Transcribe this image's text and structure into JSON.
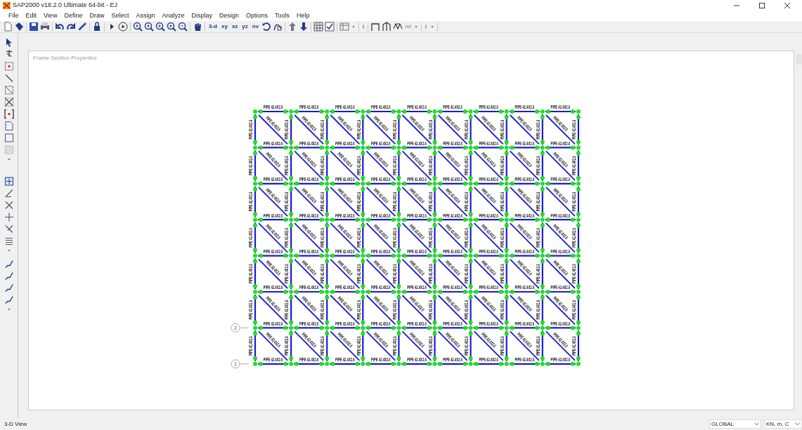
{
  "window": {
    "title": "SAP2000 v18.2.0 Ultimate 64-bit - EJ"
  },
  "menu": [
    "File",
    "Edit",
    "View",
    "Define",
    "Draw",
    "Select",
    "Assign",
    "Analyze",
    "Display",
    "Design",
    "Options",
    "Tools",
    "Help"
  ],
  "toolbar": {
    "view_buttons": [
      "3-d",
      "xy",
      "xz",
      "yz",
      "nv"
    ],
    "nd_button": "nd"
  },
  "viewport": {
    "title": "Frame Section Properties",
    "frame": {
      "levels": [
        {
          "beam_labels": [
            "PIPE 42.4X2.6",
            "PIPE 42.4X2.6",
            "PIPE 42.4X2.6",
            "PIPE 42.4X2.6",
            "PIPE 42.4X2.6",
            "PIPE 42.4X2.6",
            "PIPE 42.4X2.6",
            "PIPE 42.4X2.6",
            "PIPE 42.4X2.6"
          ]
        },
        {
          "beam_labels": [
            "PIPE 42.4X2.6",
            "PIPE 42.4X2.6",
            "PIPE 42.4X2.6",
            "PIPE 42.4X2.6",
            "PIPE 42.4X2.6",
            "PIPE 42.4X2.6",
            "PIPE 42.4X2.6",
            "PIPE 42.4X2.6",
            "PIPE 42.4X2.6"
          ]
        },
        {
          "beam_labels": [
            "PIPE 42.4X2.6",
            "PIPE 42.4X2.6",
            "PIPE 42.4X2.6",
            "PIPE 42.4X2.6",
            "PIPE 42.4X2.6",
            "PIPE 42.4X2.6",
            "PIPE 42.4X2.6",
            "PIPE 42.4X2.6",
            "PIPE 42.4X2.6"
          ]
        },
        {
          "beam_labels": [
            "PIPE 42.4X2.6",
            "PIPE 42.4X2.6",
            "PIPE 42.4X2.6",
            "PIPE 42.4X2.6",
            "PIPE 42.4X2.6",
            "PIPE 42.4X2.6",
            "PIPE 42.4X2.6",
            "PIPE 42.4X2.6",
            "PIPE 42.4X2.6"
          ]
        },
        {
          "beam_labels": [
            "PIPE 42.4X2.6",
            "PIPE 42.4X2.6",
            "PIPE 42.4X2.6",
            "PIPE 42.4X2.6",
            "PIPE 42.4X2.6",
            "PIPE 42.4X2.6",
            "PIPE 42.4X2.6",
            "PIPE 42.4X2.6",
            "PIPE 42.4X2.6"
          ]
        },
        {
          "beam_labels": [
            "PIPE 42.4X2.6",
            "PIPE 42.4X2.6",
            "PIPE 42.4X2.6",
            "PIPE 42.4X2.6",
            "PIPE 42.4X2.6",
            "PIPE 42.4X2.6",
            "PIPE 42.4X2.6",
            "PIPE 42.4X2.6",
            "PIPE 42.4X2.6"
          ]
        },
        {
          "beam_labels": [
            "PIPE 42.4X2.6",
            "PIPE 42.4X2.6",
            "PIPE 42.4X2.6",
            "PIPE 42.4X2.6",
            "PIPE 42.4X2.6",
            "PIPE 42.4X2.6",
            "PIPE 42.4X2.6",
            "PIPE 42.4X2.6",
            "PIPE 42.4X2.6"
          ]
        },
        {
          "beam_labels": [
            "PIPE 42.4X2.6",
            "PIPE 42.4X2.6",
            "PIPE 42.4X2.6",
            "PIPE 42.4X2.6",
            "PIPE 42.4X2.6",
            "PIPE 42.4X2.6",
            "PIPE 42.4X2.6",
            "PIPE 42.4X2.6",
            "PIPE 42.4X2.6"
          ]
        }
      ],
      "stories": [
        {
          "column_labels": [
            "PIPE 42.4X2.6",
            "PIPE 42.4X2.6",
            "PIPE 42.4X2.6",
            "PIPE 42.4X2.6",
            "PIPE 42.4X2.6",
            "PIPE 42.4X2.6",
            "PIPE 42.4X2.6",
            "PIPE 42.4X2.6",
            "PIPE 42.4X2.6",
            "PIPE 42.4X2.6"
          ],
          "brace_labels": [
            "PIPE 42.4X2.6",
            "PIPE 42.4X2.6",
            "PIPE 42.4X2.6",
            "PIPE 42.4X2.6",
            "PIPE 42.4X2.6",
            "PIPE 42.4X2.6",
            "PIPE 42.4X2.6",
            "PIPE 42.4X2.6",
            "PIPE 42.4X2.6"
          ]
        },
        {
          "column_labels": [
            "PIPE 42.4X2.6",
            "PIPE 42.4X2.6",
            "PIPE 42.4X2.6",
            "PIPE 42.4X2.6",
            "PIPE 42.4X2.6",
            "PIPE 42.4X2.6",
            "PIPE 42.4X2.6",
            "PIPE 42.4X2.6",
            "PIPE 42.4X2.6",
            "PIPE 42.4X2.6"
          ],
          "brace_labels": [
            "PIPE 42.4X2.6",
            "PIPE 42.4X2.6",
            "PIPE 42.4X2.6",
            "PIPE 42.4X2.6",
            "PIPE 42.4X2.6",
            "PIPE 42.4X2.6",
            "PIPE 42.4X2.6",
            "PIPE 42.4X2.6",
            "PIPE 42.4X2.6"
          ]
        },
        {
          "column_labels": [
            "PIPE 42.4X2.6",
            "PIPE 42.4X2.6",
            "PIPE 42.4X2.6",
            "PIPE 42.4X2.6",
            "PIPE 42.4X2.6",
            "PIPE 42.4X2.6",
            "PIPE 42.4X2.6",
            "PIPE 42.4X2.6",
            "PIPE 42.4X2.6",
            "PIPE 42.4X2.6"
          ],
          "brace_labels": [
            "PIPE 42.4X2.6",
            "PIPE 42.4X2.6",
            "PIPE 42.4X2.6",
            "PIPE 42.4X2.6",
            "PIPE 42.4X2.6",
            "PIPE 42.4X2.6",
            "PIPE 42.4X2.6",
            "PIPE 42.4X2.6",
            "PIPE 42.4X2.6"
          ]
        },
        {
          "column_labels": [
            "PIPE 42.4X2.6",
            "PIPE 42.4X2.6",
            "PIPE 42.4X2.6",
            "PIPE 42.4X2.6",
            "PIPE 42.4X2.6",
            "PIPE 42.4X2.6",
            "PIPE 42.4X2.6",
            "PIPE 42.4X2.6",
            "PIPE 42.4X2.6",
            "PIPE 42.4X2.6"
          ],
          "brace_labels": [
            "PIPE 42.4X2.6",
            "PIPE 42.4X2.6",
            "PIPE 42.4X2.6",
            "PIPE 42.4X2.6",
            "PIPE 42.4X2.6",
            "PIPE 42.4X2.6",
            "PIPE 42.4X2.6",
            "PIPE 42.4X2.6",
            "PIPE 42.4X2.6"
          ]
        },
        {
          "column_labels": [
            "PIPE 42.4X2.6",
            "PIPE 42.4X2.6",
            "PIPE 42.4X2.6",
            "PIPE 42.4X2.6",
            "PIPE 42.4X2.6",
            "PIPE 42.4X2.6",
            "PIPE 42.4X2.6",
            "PIPE 42.4X2.6",
            "PIPE 42.4X2.6",
            "PIPE 42.4X2.6"
          ],
          "brace_labels": [
            "PIPE 42.4X2.6",
            "PIPE 42.4X2.6",
            "PIPE 42.4X2.6",
            "PIPE 42.4X2.6",
            "PIPE 42.4X2.6",
            "PIPE 42.4X2.6",
            "PIPE 42.4X2.6",
            "PIPE 42.4X2.6",
            "PIPE 42.4X2.6"
          ]
        },
        {
          "column_labels": [
            "PIPE 42.4X2.6",
            "PIPE 42.4X2.6",
            "PIPE 42.4X2.6",
            "PIPE 42.4X2.6",
            "PIPE 42.4X2.6",
            "PIPE 42.4X2.6",
            "PIPE 42.4X2.6",
            "PIPE 42.4X2.6",
            "PIPE 42.4X2.6",
            "PIPE 42.4X2.6"
          ],
          "brace_labels": [
            "PIPE 42.4X2.6",
            "PIPE 42.4X2.6",
            "PIPE 42.4X2.6",
            "PIPE 42.4X2.6",
            "PIPE 42.4X2.6",
            "PIPE 42.4X2.6",
            "PIPE 42.4X2.6",
            "PIPE 42.4X2.6",
            "PIPE 42.4X2.6"
          ]
        },
        {
          "column_labels": [
            "PIPE 42.4X2.6",
            "PIPE 42.4X2.6",
            "PIPE 42.4X2.6",
            "PIPE 42.4X2.6",
            "PIPE 42.4X2.6",
            "PIPE 42.4X2.6",
            "PIPE 42.4X2.6",
            "PIPE 42.4X2.6",
            "PIPE 42.4X2.6",
            "PIPE 42.4X2.6"
          ],
          "brace_labels": [
            "PIPE 42.4X2.6",
            "PIPE 42.4X2.6",
            "PIPE 42.4X2.6",
            "PIPE 42.4X2.6",
            "PIPE 42.4X2.6",
            "PIPE 42.4X2.6",
            "PIPE 42.4X2.6",
            "PIPE 42.4X2.6",
            "PIPE 42.4X2.6"
          ]
        }
      ]
    },
    "grid_bubbles": [
      "2",
      "1"
    ]
  },
  "status_bar": {
    "view": "3-D View",
    "coordinate_system": "GLOBAL",
    "units": "KN, m, C"
  }
}
